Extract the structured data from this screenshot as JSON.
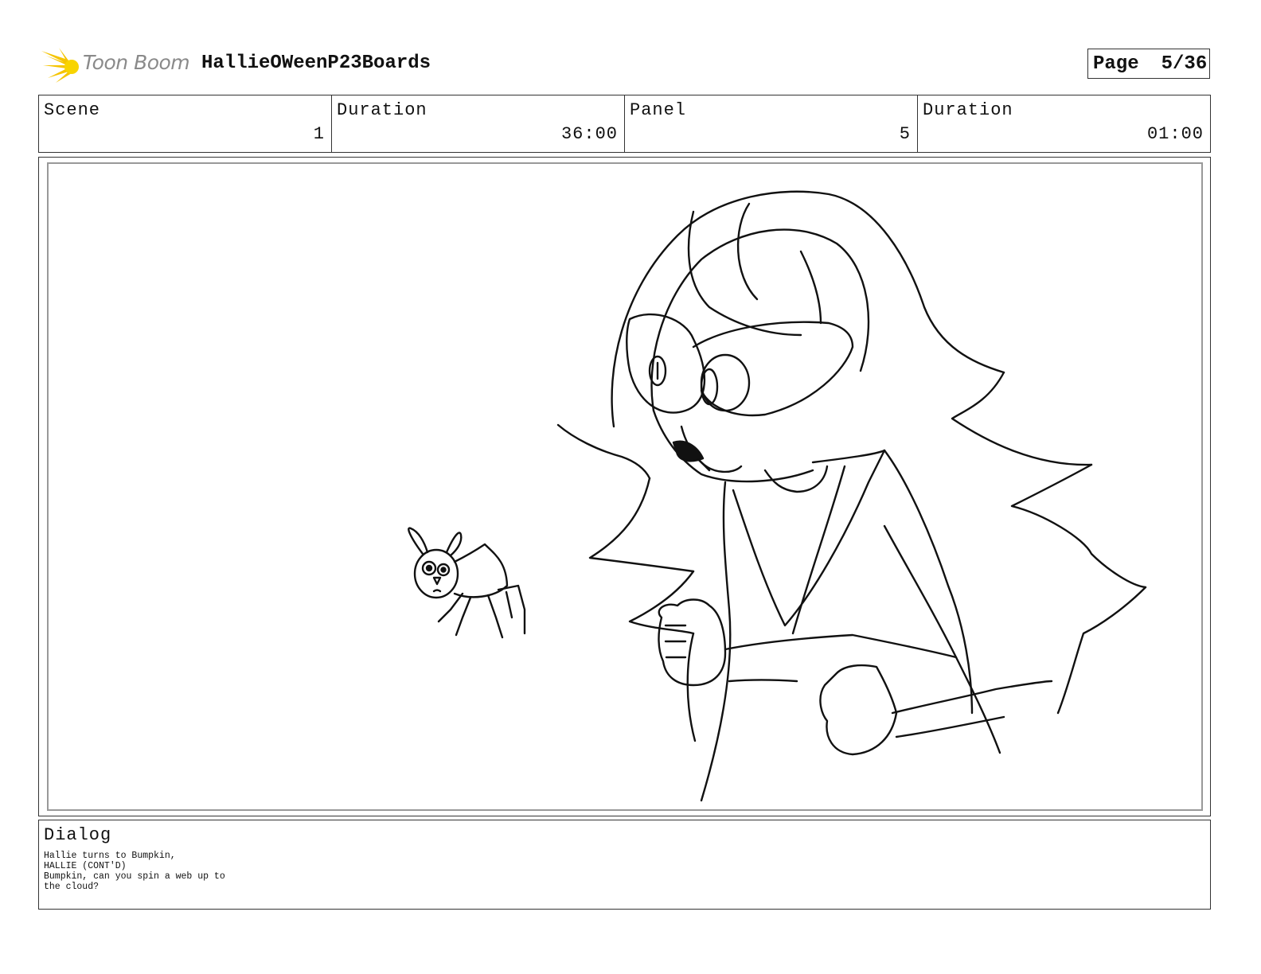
{
  "header": {
    "logo_text": "Toon Boom",
    "project_title": "HallieOWeenP23Boards",
    "page_label": "Page",
    "page_value": "5/36"
  },
  "info": {
    "scene_label": "Scene",
    "scene_value": "1",
    "scene_duration_label": "Duration",
    "scene_duration_value": "36:00",
    "panel_label": "Panel",
    "panel_value": "5",
    "panel_duration_label": "Duration",
    "panel_duration_value": "01:00"
  },
  "dialog": {
    "title": "Dialog",
    "lines": [
      "Hallie turns to Bumpkin,",
      "HALLIE (CONT'D)",
      "Bumpkin, can you spin a web up to",
      "the cloud?"
    ]
  },
  "icons": {
    "logo": "starburst-logo-icon"
  },
  "colors": {
    "logo_burst": "#f5c400",
    "logo_text": "#8a8a8a"
  }
}
